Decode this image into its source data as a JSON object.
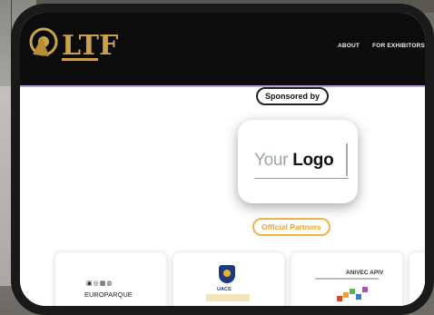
{
  "nav": {
    "logo_text": "LTF",
    "links": [
      "ABOUT",
      "FOR EXHIBITORS"
    ]
  },
  "sponsor": {
    "pill_label": "Sponsored by",
    "logo_your": "Your",
    "logo_word": "Logo"
  },
  "partners": {
    "pill_label": "Official Partners",
    "cards": [
      {
        "name": "EUROPARQUE",
        "icons": "▣◎▦◍"
      },
      {
        "name": "UACS"
      },
      {
        "name": "ANIVEC APIV"
      }
    ]
  },
  "colors": {
    "nav_bg": "#0c0c0c",
    "gold": "#c9a24a",
    "partners_orange": "#f2b04a"
  }
}
